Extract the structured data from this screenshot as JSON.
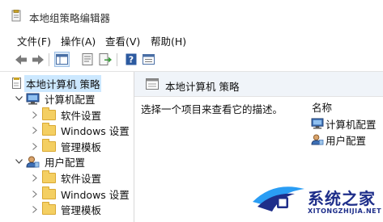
{
  "window": {
    "title": "本地组策略编辑器"
  },
  "menu": [
    "文件(F)",
    "操作(A)",
    "查看(V)",
    "帮助(H)"
  ],
  "toolbar": {
    "buttons": [
      "back-arrow-icon",
      "forward-arrow-icon",
      "show-tree-icon",
      "properties-icon",
      "export-list-icon",
      "help-icon",
      "view-icon"
    ]
  },
  "tree": {
    "root": "本地计算机 策略",
    "computer_config": "计算机配置",
    "user_config": "用户配置",
    "computer_children": [
      "软件设置",
      "Windows 设置",
      "管理模板"
    ],
    "user_children": [
      "软件设置",
      "Windows 设置",
      "管理模板"
    ]
  },
  "content": {
    "header_title": "本地计算机 策略",
    "description": "选择一个项目来查看它的描述。",
    "column_name": "名称",
    "items": [
      "计算机配置",
      "用户配置"
    ]
  },
  "watermark": {
    "cn": "系统之家",
    "en": "XITONGZHIJIA.NET"
  },
  "colors": {
    "selection": "#cce8ff",
    "folder": "#f4cf62",
    "header_bg": "#f0f4f9",
    "watermark": "#1e2e8a"
  }
}
